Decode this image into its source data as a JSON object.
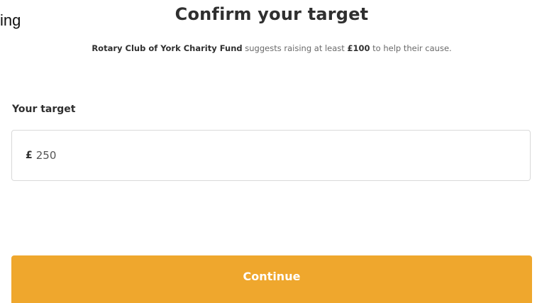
{
  "page": {
    "left_fragment": "ing",
    "title": "Confirm your target",
    "subtitle": {
      "charity_name": "Rotary Club of York Charity Fund",
      "text_before_amount": " suggests raising at least ",
      "suggested_amount": "£100",
      "text_after_amount": " to help their cause."
    }
  },
  "target_field": {
    "label": "Your target",
    "currency_symbol": "£",
    "value": "250"
  },
  "continue_button": {
    "label": "Continue",
    "color": "#efa72d"
  }
}
